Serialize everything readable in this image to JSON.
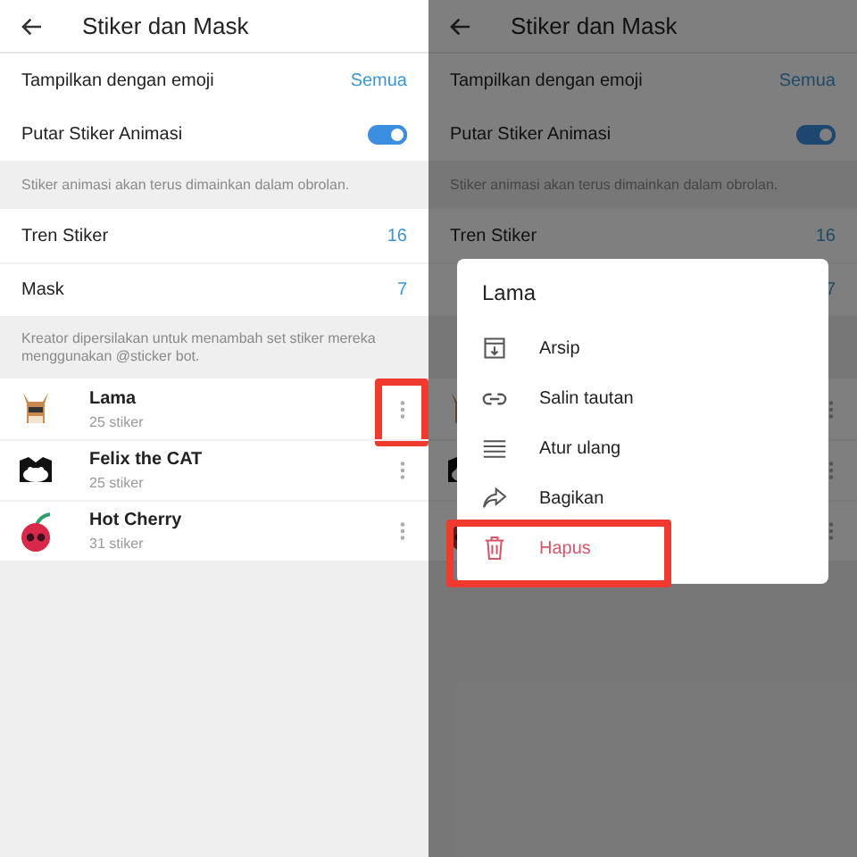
{
  "screens": [
    {
      "header": {
        "title": "Stiker dan Mask"
      },
      "settings": [
        {
          "kind": "value",
          "label": "Tampilkan dengan emoji",
          "value": "Semua"
        },
        {
          "kind": "toggle",
          "label": "Putar Stiker Animasi",
          "on": true
        }
      ],
      "settings_note": "Stiker animasi akan terus dimainkan dalam obrolan.",
      "counts": [
        {
          "label": "Tren Stiker",
          "value": "16"
        },
        {
          "label": "Mask",
          "value": "7"
        }
      ],
      "counts_note": "Kreator dipersilakan untuk menambah set stiker mereka menggunakan @sticker bot.",
      "sticker_sets": [
        {
          "kind": "llama",
          "name": "Lama",
          "count": "25 stiker",
          "highlighted": true
        },
        {
          "kind": "cat",
          "name": "Felix the CAT",
          "count": "25 stiker",
          "highlighted": false
        },
        {
          "kind": "cherry",
          "name": "Hot Cherry",
          "count": "31 stiker",
          "highlighted": false
        }
      ]
    },
    {
      "dimmed": true,
      "header": {
        "title": "Stiker dan Mask"
      },
      "settings": [
        {
          "kind": "value",
          "label": "Tampilkan dengan emoji",
          "value": "Semua"
        },
        {
          "kind": "toggle",
          "label": "Putar Stiker Animasi",
          "on": true
        }
      ],
      "settings_note": "Stiker animasi akan terus dimainkan dalam obrolan.",
      "counts": [
        {
          "label": "Tren Stiker",
          "value": "16"
        },
        {
          "value": "7"
        }
      ],
      "sticker_sets": [
        {
          "kind": "llama"
        },
        {
          "kind": "cat"
        },
        {
          "kind": "cherry"
        }
      ],
      "menu": {
        "title": "Lama",
        "items": [
          {
            "kind": "archive",
            "label": "Arsip",
            "danger": false,
            "highlighted": false
          },
          {
            "kind": "link",
            "label": "Salin tautan",
            "danger": false,
            "highlighted": false
          },
          {
            "kind": "reorder",
            "label": "Atur ulang",
            "danger": false,
            "highlighted": false
          },
          {
            "kind": "share",
            "label": "Bagikan",
            "danger": false,
            "highlighted": false
          },
          {
            "kind": "delete",
            "label": "Hapus",
            "danger": true,
            "highlighted": true
          }
        ]
      }
    }
  ]
}
